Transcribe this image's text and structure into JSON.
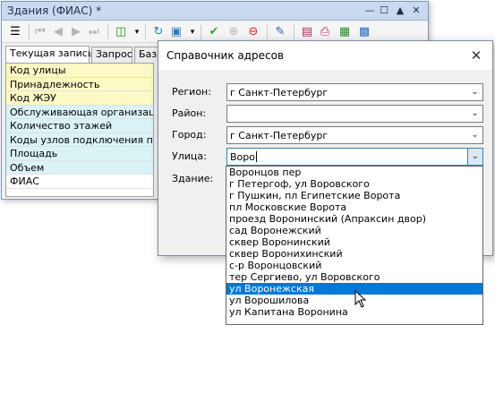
{
  "bg_window": {
    "title": "Здания (ФИАС) *",
    "tabs": [
      "Текущая запись",
      "Запрос",
      "База"
    ],
    "rows": [
      {
        "label": "Код улицы",
        "color": "#fdf9c4"
      },
      {
        "label": "Принадлежность",
        "color": "#fdf9c4"
      },
      {
        "label": "Код ЖЭУ",
        "color": "#fdf9c4"
      },
      {
        "label": "Обслуживающая организация",
        "color": "#daf3f7"
      },
      {
        "label": "Количество этажей",
        "color": "#daf3f7"
      },
      {
        "label": "Коды узлов подключения потр.",
        "color": "#daf3f7"
      },
      {
        "label": "Площадь",
        "color": "#daf3f7"
      },
      {
        "label": "Объем",
        "color": "#daf3f7"
      },
      {
        "label": "ФИАС",
        "color": "#ffffff"
      }
    ]
  },
  "dialog": {
    "title": "Справочник адресов",
    "region_label": "Регион:",
    "region_value": "г Санкт-Петербург",
    "district_label": "Район:",
    "district_value": "",
    "city_label": "Город:",
    "city_value": "г Санкт-Петербург",
    "street_label": "Улица:",
    "street_value": "Воро",
    "building_label": "Здание:"
  },
  "dropdown": {
    "items": [
      "Воронцов пер",
      "г Петергоф, ул Воровского",
      "г Пушкин, пл Египетские Ворота",
      "пл Московские Ворота",
      "проезд Воронинский (Апраксин двор)",
      "сад Воронежский",
      "сквер Воронинский",
      "сквер Воронихинский",
      "с-р Воронцовский",
      "тер Сергиево, ул Воровского",
      "ул Воронежская",
      "ул Ворошилова",
      "ул Капитана Воронина"
    ],
    "selected_index": 10
  },
  "colors": {
    "selection": "#0078d7",
    "titlebar": "#c9d9ef"
  }
}
